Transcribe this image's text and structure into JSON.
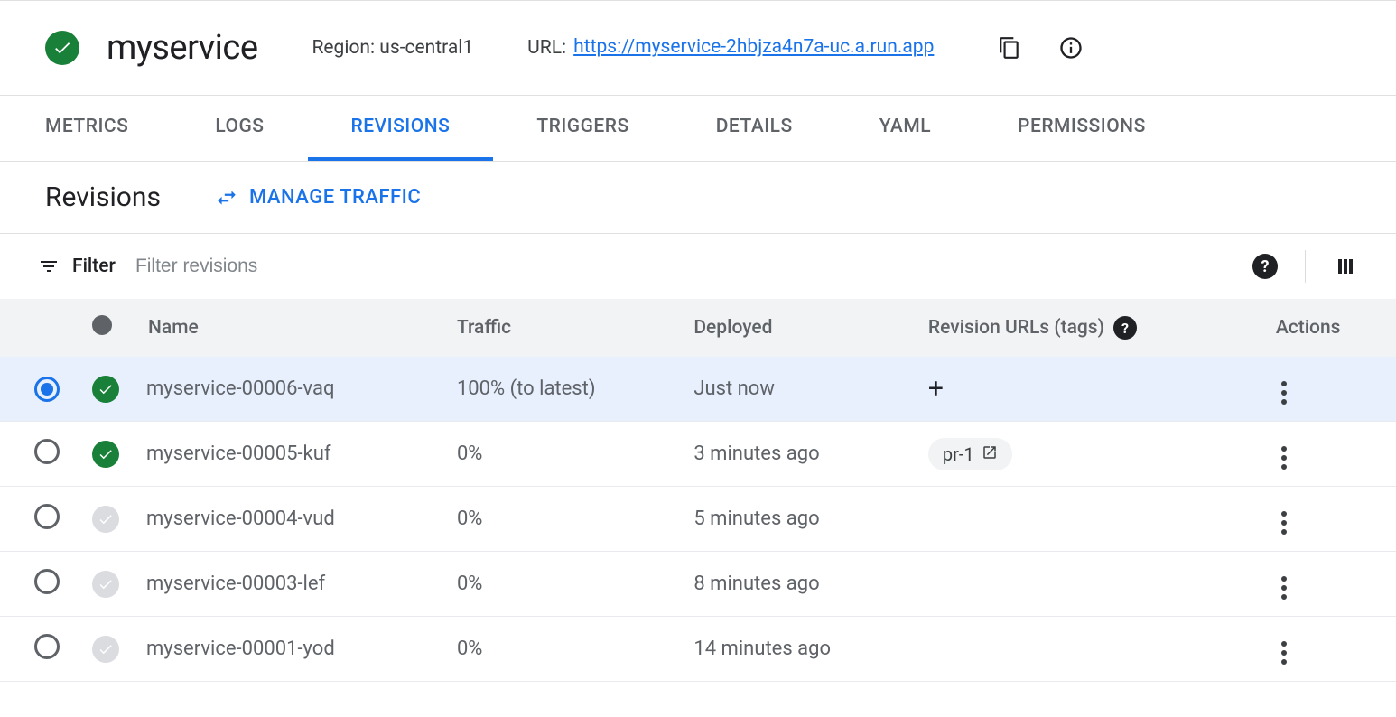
{
  "header": {
    "service_name": "myservice",
    "region_label": "Region: us-central1",
    "url_label": "URL:",
    "url_value": "https://myservice-2hbjza4n7a-uc.a.run.app"
  },
  "tabs": [
    {
      "label": "METRICS",
      "active": false
    },
    {
      "label": "LOGS",
      "active": false
    },
    {
      "label": "REVISIONS",
      "active": true
    },
    {
      "label": "TRIGGERS",
      "active": false
    },
    {
      "label": "DETAILS",
      "active": false
    },
    {
      "label": "YAML",
      "active": false
    },
    {
      "label": "PERMISSIONS",
      "active": false
    }
  ],
  "section": {
    "title": "Revisions",
    "manage_traffic_label": "MANAGE TRAFFIC"
  },
  "filter": {
    "label": "Filter",
    "placeholder": "Filter revisions"
  },
  "table": {
    "headers": {
      "name": "Name",
      "traffic": "Traffic",
      "deployed": "Deployed",
      "revision_urls": "Revision URLs (tags)",
      "actions": "Actions"
    },
    "rows": [
      {
        "selected": true,
        "status": "green",
        "name": "myservice-00006-vaq",
        "traffic": "100% (to latest)",
        "deployed": "Just now",
        "tag": null,
        "add_tag": true
      },
      {
        "selected": false,
        "status": "green",
        "name": "myservice-00005-kuf",
        "traffic": "0%",
        "deployed": "3 minutes ago",
        "tag": "pr-1",
        "add_tag": false
      },
      {
        "selected": false,
        "status": "gray",
        "name": "myservice-00004-vud",
        "traffic": "0%",
        "deployed": "5 minutes ago",
        "tag": null,
        "add_tag": false
      },
      {
        "selected": false,
        "status": "gray",
        "name": "myservice-00003-lef",
        "traffic": "0%",
        "deployed": "8 minutes ago",
        "tag": null,
        "add_tag": false
      },
      {
        "selected": false,
        "status": "gray",
        "name": "myservice-00001-yod",
        "traffic": "0%",
        "deployed": "14 minutes ago",
        "tag": null,
        "add_tag": false
      }
    ]
  }
}
